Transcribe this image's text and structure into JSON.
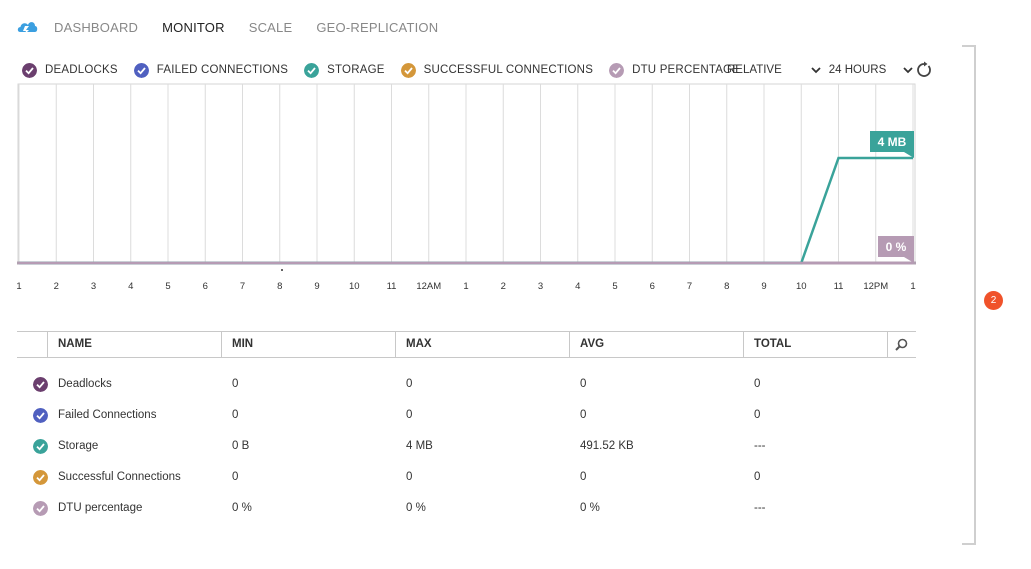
{
  "nav": {
    "tabs": [
      "DASHBOARD",
      "MONITOR",
      "SCALE",
      "GEO-REPLICATION"
    ],
    "active_tab": "MONITOR"
  },
  "legend": [
    {
      "label": "DEADLOCKS",
      "color": "#6b3f6e"
    },
    {
      "label": "FAILED CONNECTIONS",
      "color": "#5060c0"
    },
    {
      "label": "STORAGE",
      "color": "#3aa39a"
    },
    {
      "label": "SUCCESSFUL CONNECTIONS",
      "color": "#d4973a"
    },
    {
      "label": "DTU PERCENTAGE",
      "color": "#b69bb4"
    }
  ],
  "controls": {
    "scale": "RELATIVE",
    "range": "24 HOURS"
  },
  "chart_data": {
    "type": "line",
    "x_ticks": [
      "1",
      "2",
      "3",
      "4",
      "5",
      "6",
      "7",
      "8",
      "9",
      "10",
      "11",
      "12AM",
      "1",
      "2",
      "3",
      "4",
      "5",
      "6",
      "7",
      "8",
      "9",
      "10",
      "11",
      "12PM",
      "1"
    ],
    "series": [
      {
        "name": "STORAGE",
        "color": "#3aa39a",
        "end_label": "4 MB",
        "points": [
          [
            0,
            0
          ],
          [
            21,
            0
          ],
          [
            22,
            4
          ],
          [
            24,
            4
          ]
        ]
      },
      {
        "name": "DTU PERCENTAGE",
        "color": "#b69bb4",
        "end_label": "0 %",
        "points": [
          [
            0,
            0
          ],
          [
            24,
            0
          ]
        ]
      }
    ],
    "grid": true
  },
  "table": {
    "columns": [
      "NAME",
      "MIN",
      "MAX",
      "AVG",
      "TOTAL"
    ],
    "rows": [
      {
        "color": "#6b3f6e",
        "name": "Deadlocks",
        "min": "0",
        "max": "0",
        "avg": "0",
        "total": "0"
      },
      {
        "color": "#5060c0",
        "name": "Failed Connections",
        "min": "0",
        "max": "0",
        "avg": "0",
        "total": "0"
      },
      {
        "color": "#3aa39a",
        "name": "Storage",
        "min": "0 B",
        "max": "4 MB",
        "avg": "491.52 KB",
        "total": "---"
      },
      {
        "color": "#d4973a",
        "name": "Successful Connections",
        "min": "0",
        "max": "0",
        "avg": "0",
        "total": "0"
      },
      {
        "color": "#b69bb4",
        "name": "DTU percentage",
        "min": "0 %",
        "max": "0 %",
        "avg": "0 %",
        "total": "---"
      }
    ]
  },
  "notification_count": "2"
}
